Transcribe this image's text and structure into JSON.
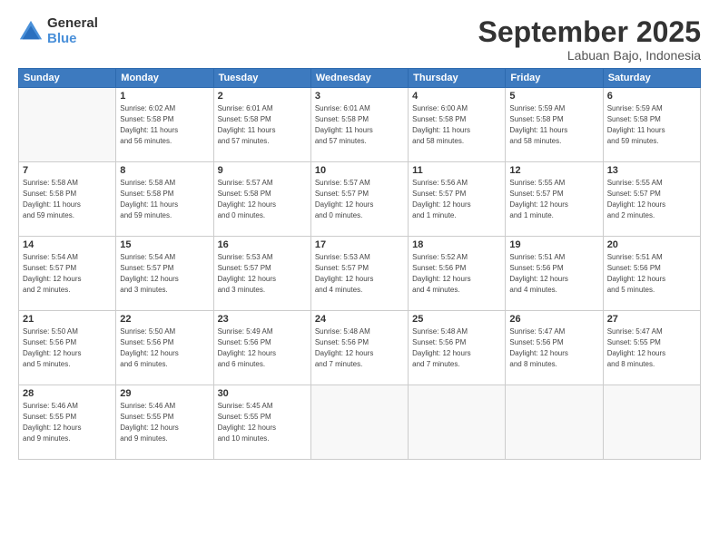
{
  "logo": {
    "general": "General",
    "blue": "Blue"
  },
  "header": {
    "month": "September 2025",
    "location": "Labuan Bajo, Indonesia"
  },
  "weekdays": [
    "Sunday",
    "Monday",
    "Tuesday",
    "Wednesday",
    "Thursday",
    "Friday",
    "Saturday"
  ],
  "weeks": [
    [
      {
        "day": "",
        "info": ""
      },
      {
        "day": "1",
        "info": "Sunrise: 6:02 AM\nSunset: 5:58 PM\nDaylight: 11 hours\nand 56 minutes."
      },
      {
        "day": "2",
        "info": "Sunrise: 6:01 AM\nSunset: 5:58 PM\nDaylight: 11 hours\nand 57 minutes."
      },
      {
        "day": "3",
        "info": "Sunrise: 6:01 AM\nSunset: 5:58 PM\nDaylight: 11 hours\nand 57 minutes."
      },
      {
        "day": "4",
        "info": "Sunrise: 6:00 AM\nSunset: 5:58 PM\nDaylight: 11 hours\nand 58 minutes."
      },
      {
        "day": "5",
        "info": "Sunrise: 5:59 AM\nSunset: 5:58 PM\nDaylight: 11 hours\nand 58 minutes."
      },
      {
        "day": "6",
        "info": "Sunrise: 5:59 AM\nSunset: 5:58 PM\nDaylight: 11 hours\nand 59 minutes."
      }
    ],
    [
      {
        "day": "7",
        "info": "Sunrise: 5:58 AM\nSunset: 5:58 PM\nDaylight: 11 hours\nand 59 minutes."
      },
      {
        "day": "8",
        "info": "Sunrise: 5:58 AM\nSunset: 5:58 PM\nDaylight: 11 hours\nand 59 minutes."
      },
      {
        "day": "9",
        "info": "Sunrise: 5:57 AM\nSunset: 5:58 PM\nDaylight: 12 hours\nand 0 minutes."
      },
      {
        "day": "10",
        "info": "Sunrise: 5:57 AM\nSunset: 5:57 PM\nDaylight: 12 hours\nand 0 minutes."
      },
      {
        "day": "11",
        "info": "Sunrise: 5:56 AM\nSunset: 5:57 PM\nDaylight: 12 hours\nand 1 minute."
      },
      {
        "day": "12",
        "info": "Sunrise: 5:55 AM\nSunset: 5:57 PM\nDaylight: 12 hours\nand 1 minute."
      },
      {
        "day": "13",
        "info": "Sunrise: 5:55 AM\nSunset: 5:57 PM\nDaylight: 12 hours\nand 2 minutes."
      }
    ],
    [
      {
        "day": "14",
        "info": "Sunrise: 5:54 AM\nSunset: 5:57 PM\nDaylight: 12 hours\nand 2 minutes."
      },
      {
        "day": "15",
        "info": "Sunrise: 5:54 AM\nSunset: 5:57 PM\nDaylight: 12 hours\nand 3 minutes."
      },
      {
        "day": "16",
        "info": "Sunrise: 5:53 AM\nSunset: 5:57 PM\nDaylight: 12 hours\nand 3 minutes."
      },
      {
        "day": "17",
        "info": "Sunrise: 5:53 AM\nSunset: 5:57 PM\nDaylight: 12 hours\nand 4 minutes."
      },
      {
        "day": "18",
        "info": "Sunrise: 5:52 AM\nSunset: 5:56 PM\nDaylight: 12 hours\nand 4 minutes."
      },
      {
        "day": "19",
        "info": "Sunrise: 5:51 AM\nSunset: 5:56 PM\nDaylight: 12 hours\nand 4 minutes."
      },
      {
        "day": "20",
        "info": "Sunrise: 5:51 AM\nSunset: 5:56 PM\nDaylight: 12 hours\nand 5 minutes."
      }
    ],
    [
      {
        "day": "21",
        "info": "Sunrise: 5:50 AM\nSunset: 5:56 PM\nDaylight: 12 hours\nand 5 minutes."
      },
      {
        "day": "22",
        "info": "Sunrise: 5:50 AM\nSunset: 5:56 PM\nDaylight: 12 hours\nand 6 minutes."
      },
      {
        "day": "23",
        "info": "Sunrise: 5:49 AM\nSunset: 5:56 PM\nDaylight: 12 hours\nand 6 minutes."
      },
      {
        "day": "24",
        "info": "Sunrise: 5:48 AM\nSunset: 5:56 PM\nDaylight: 12 hours\nand 7 minutes."
      },
      {
        "day": "25",
        "info": "Sunrise: 5:48 AM\nSunset: 5:56 PM\nDaylight: 12 hours\nand 7 minutes."
      },
      {
        "day": "26",
        "info": "Sunrise: 5:47 AM\nSunset: 5:56 PM\nDaylight: 12 hours\nand 8 minutes."
      },
      {
        "day": "27",
        "info": "Sunrise: 5:47 AM\nSunset: 5:55 PM\nDaylight: 12 hours\nand 8 minutes."
      }
    ],
    [
      {
        "day": "28",
        "info": "Sunrise: 5:46 AM\nSunset: 5:55 PM\nDaylight: 12 hours\nand 9 minutes."
      },
      {
        "day": "29",
        "info": "Sunrise: 5:46 AM\nSunset: 5:55 PM\nDaylight: 12 hours\nand 9 minutes."
      },
      {
        "day": "30",
        "info": "Sunrise: 5:45 AM\nSunset: 5:55 PM\nDaylight: 12 hours\nand 10 minutes."
      },
      {
        "day": "",
        "info": ""
      },
      {
        "day": "",
        "info": ""
      },
      {
        "day": "",
        "info": ""
      },
      {
        "day": "",
        "info": ""
      }
    ]
  ]
}
